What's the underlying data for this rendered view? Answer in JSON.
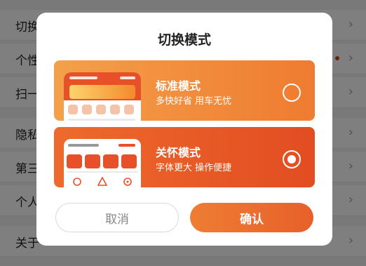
{
  "background": {
    "rows": [
      {
        "label": "切换模式",
        "has_dot": false
      },
      {
        "label": "个性化推荐",
        "has_dot": true
      },
      {
        "label": "扫一扫",
        "has_dot": false
      },
      {
        "label": "隐私设置",
        "has_dot": false
      },
      {
        "label": "第三方信息共享清单",
        "has_dot": false
      },
      {
        "label": "个人信息收集清单",
        "has_dot": false
      },
      {
        "label": "关于",
        "has_dot": false
      }
    ],
    "chevron": "›"
  },
  "dialog": {
    "title": "切换模式",
    "modes": [
      {
        "title": "标准模式",
        "subtitle": "多快好省 用车无忧",
        "selected": false
      },
      {
        "title": "关怀模式",
        "subtitle": "字体更大 操作便捷",
        "selected": true
      }
    ],
    "cancel_label": "取消",
    "confirm_label": "确认"
  },
  "colors": {
    "accent": "#ee6a2c",
    "standard_card": "#f4a04b",
    "care_card": "#e24d22"
  }
}
